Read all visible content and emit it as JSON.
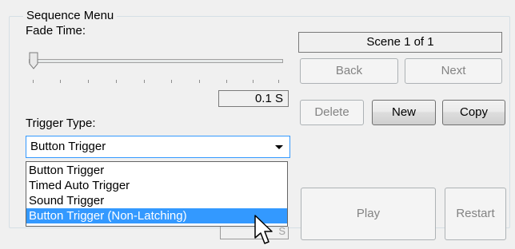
{
  "group_title": "Sequence Menu",
  "fade_time": {
    "label": "Fade Time:",
    "value": "0.1 S",
    "slider_position": 0
  },
  "trigger_type": {
    "label": "Trigger Type:",
    "selected": "Button Trigger",
    "options": [
      "Button Trigger",
      "Timed Auto Trigger",
      "Sound Trigger",
      "Button Trigger (Non-Latching)"
    ],
    "highlighted_option": "Button Trigger (Non-Latching)",
    "partial_field_text": "S"
  },
  "scene": {
    "indicator": "Scene 1 of 1"
  },
  "buttons": {
    "back": "Back",
    "next": "Next",
    "delete": "Delete",
    "new": "New",
    "copy": "Copy",
    "play": "Play",
    "restart": "Restart"
  },
  "colors": {
    "selection": "#3399ff",
    "background": "#f0f0f0",
    "disabled_text": "#838383"
  },
  "icons": {
    "dropdown": "chevron-down-icon",
    "cursor": "mouse-pointer-icon"
  }
}
